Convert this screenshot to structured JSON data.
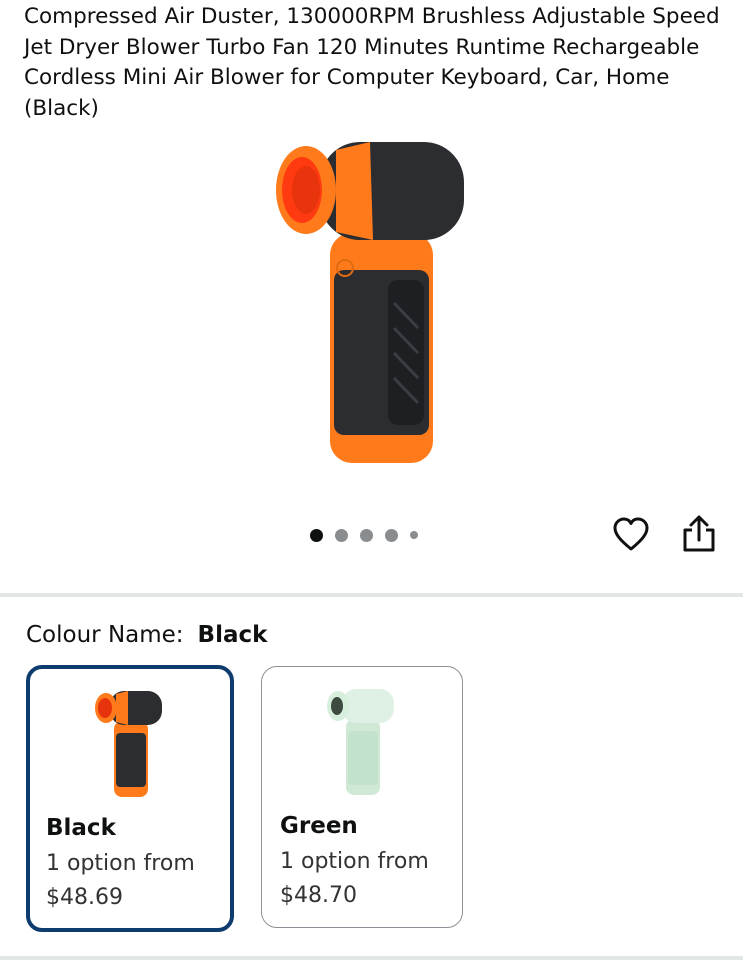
{
  "product": {
    "title": "Compressed Air Duster, 130000RPM Brushless Adjustable Speed Jet Dryer Blower Turbo Fan 120 Minutes Runtime Rechargeable Cordless Mini Air Blower for Computer Keyboard, Car, Home (Black)"
  },
  "gallery": {
    "image_count_dots": 5,
    "active_index": 0
  },
  "actions": {
    "wishlist_icon": "heart-outline-icon",
    "share_icon": "share-icon"
  },
  "variation": {
    "label": "Colour Name:",
    "selected": "Black",
    "options": [
      {
        "name": "Black",
        "availability": "1 option from",
        "price": "$48.69",
        "selected": true
      },
      {
        "name": "Green",
        "availability": "1 option from",
        "price": "$48.70",
        "selected": false
      }
    ]
  },
  "colors": {
    "selected_border": "#0e3c6e",
    "product_orange": "#ff7a1a",
    "product_black": "#2b2d31",
    "product_green": "#cfe9d6"
  }
}
